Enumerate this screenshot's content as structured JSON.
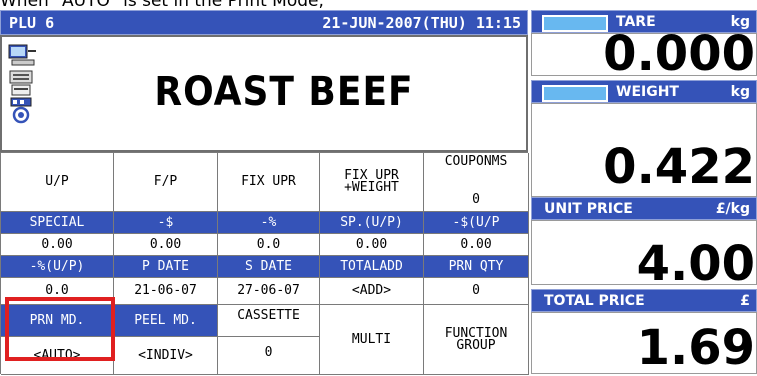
{
  "caption": "When \"AUTO\" is set in the Print Mode,",
  "header": {
    "plu": "PLU 6",
    "datetime": "21-JUN-2007(THU) 11:15"
  },
  "item": {
    "name": "ROAST BEEF",
    "icons": [
      "computer-icon",
      "printer-icon",
      "network-icon"
    ]
  },
  "grid": {
    "row1": {
      "up": "U/P",
      "fp": "F/P",
      "fix_upr": "FIX UPR",
      "fix_upr_weight_line1": "FIX UPR",
      "fix_upr_weight_line2": "+WEIGHT",
      "coupons_label": "COUPONMS",
      "coupons_value": "0"
    },
    "row2_labels": [
      "SPECIAL",
      "-$",
      "-%",
      "SP.(U/P)",
      "-$(U/P"
    ],
    "row3_values": [
      "0.00",
      "0.00",
      "0.0",
      "0.00",
      "0.00"
    ],
    "row4_labels": [
      "-%(U/P)",
      "P DATE",
      "S DATE",
      "TOTALADD",
      "PRN QTY"
    ],
    "row5_values": [
      "0.0",
      "21-06-07",
      "27-06-07",
      "<ADD>",
      "0"
    ],
    "row6": {
      "prn_md": "PRN MD.",
      "peel_md": "PEEL MD.",
      "cassette": "CASSETTE",
      "multi": "MULTI",
      "function_line1": "FUNCTION",
      "function_line2": "GROUP"
    },
    "row7": {
      "prn_md_value": "<AUTO>",
      "peel_md_value": "<INDIV>",
      "cassette_value": "0"
    }
  },
  "right": {
    "tare": {
      "label": "TARE",
      "unit": "kg",
      "value": "0.000"
    },
    "weight": {
      "label": "WEIGHT",
      "unit": "kg",
      "value": "0.422"
    },
    "unit_price": {
      "label": "UNIT PRICE",
      "unit": "£/kg",
      "value": "4.00"
    },
    "total_price": {
      "label": "TOTAL PRICE",
      "unit": "£",
      "value": "1.69"
    }
  },
  "colors": {
    "header_blue": "#3553b8",
    "indicator_blue": "#68b8f0",
    "highlight_red": "#e02020"
  }
}
